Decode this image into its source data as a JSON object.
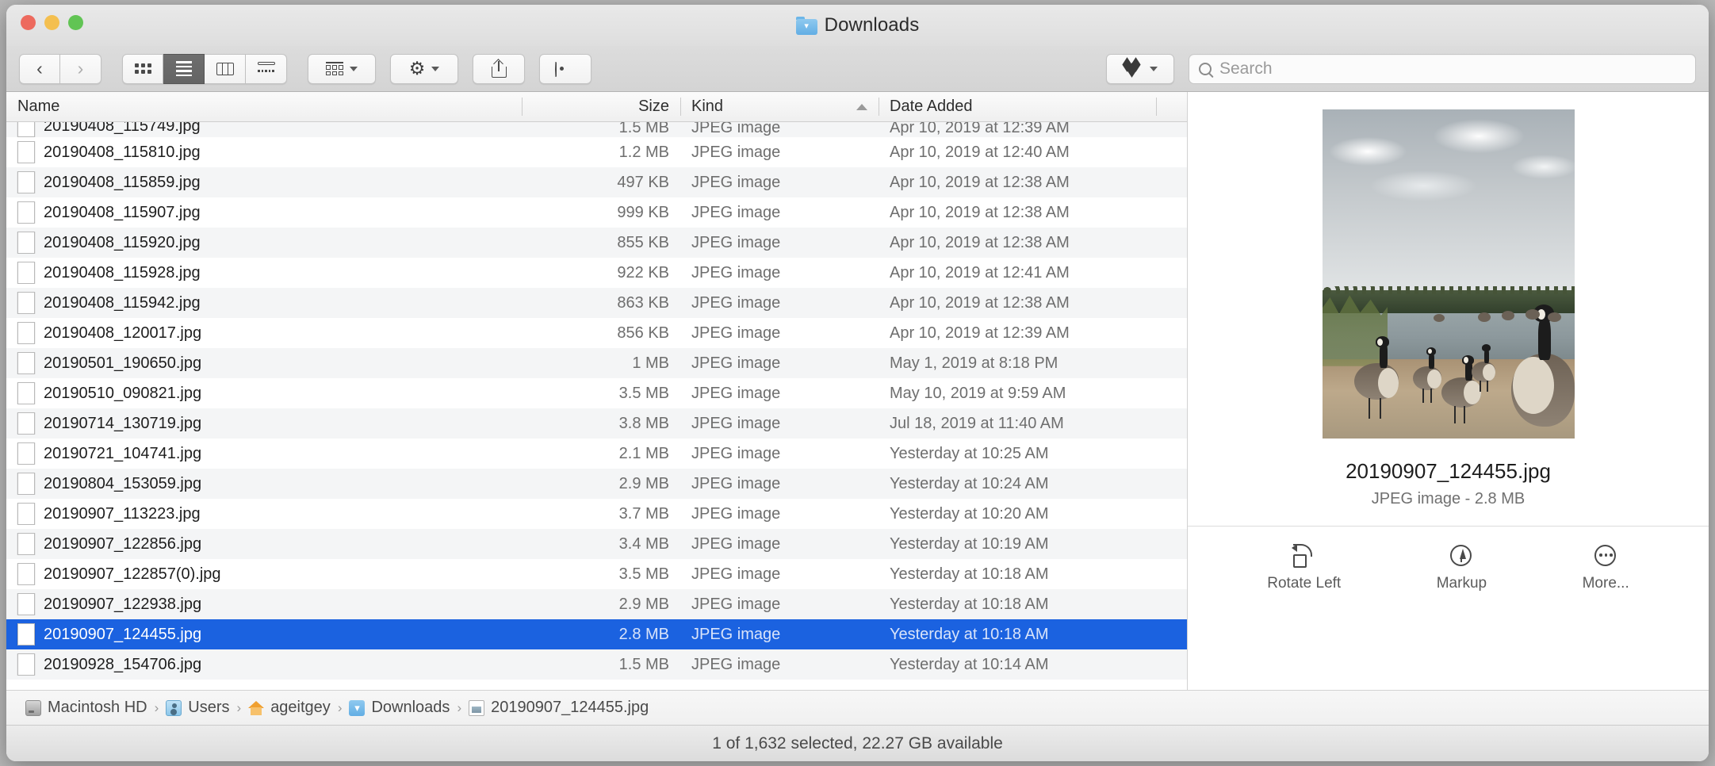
{
  "window": {
    "title": "Downloads",
    "title_icon": "downloads-folder-icon"
  },
  "toolbar": {
    "back_icon": "chevron-left-icon",
    "forward_icon": "chevron-right-icon",
    "view_icon_label": "icon-view",
    "view_list_label": "list-view",
    "view_column_label": "column-view",
    "view_gallery_label": "gallery-view",
    "arrange_label": "arrange-by",
    "action_label": "action-gear",
    "share_label": "share",
    "tags_label": "tags",
    "dropbox_label": "dropbox"
  },
  "search": {
    "placeholder": "Search",
    "value": ""
  },
  "columns": {
    "name": "Name",
    "size": "Size",
    "kind": "Kind",
    "date_added": "Date Added",
    "sorted_by": "Kind",
    "sort_direction": "ascending"
  },
  "files": [
    {
      "name": "20190408_115749.jpg",
      "size": "1.5 MB",
      "kind": "JPEG image",
      "date": "Apr 10, 2019 at 12:39 AM",
      "thumb": "#8c7a62",
      "clipped": true,
      "selected": false
    },
    {
      "name": "20190408_115810.jpg",
      "size": "1.2 MB",
      "kind": "JPEG image",
      "date": "Apr 10, 2019 at 12:40 AM",
      "thumb": "#c2aa86",
      "clipped": false,
      "selected": false
    },
    {
      "name": "20190408_115859.jpg",
      "size": "497 KB",
      "kind": "JPEG image",
      "date": "Apr 10, 2019 at 12:38 AM",
      "thumb": "#6f6252",
      "clipped": false,
      "selected": false
    },
    {
      "name": "20190408_115907.jpg",
      "size": "999 KB",
      "kind": "JPEG image",
      "date": "Apr 10, 2019 at 12:38 AM",
      "thumb": "#b09c74",
      "clipped": false,
      "selected": false
    },
    {
      "name": "20190408_115920.jpg",
      "size": "855 KB",
      "kind": "JPEG image",
      "date": "Apr 10, 2019 at 12:38 AM",
      "thumb": "#8b7a5e",
      "clipped": false,
      "selected": false
    },
    {
      "name": "20190408_115928.jpg",
      "size": "922 KB",
      "kind": "JPEG image",
      "date": "Apr 10, 2019 at 12:41 AM",
      "thumb": "#7a6a55",
      "clipped": false,
      "selected": false
    },
    {
      "name": "20190408_115942.jpg",
      "size": "863 KB",
      "kind": "JPEG image",
      "date": "Apr 10, 2019 at 12:38 AM",
      "thumb": "#9a8668",
      "clipped": false,
      "selected": false
    },
    {
      "name": "20190408_120017.jpg",
      "size": "856 KB",
      "kind": "JPEG image",
      "date": "Apr 10, 2019 at 12:39 AM",
      "thumb": "#a38f6d",
      "clipped": false,
      "selected": false
    },
    {
      "name": "20190501_190650.jpg",
      "size": "1 MB",
      "kind": "JPEG image",
      "date": "May 1, 2019 at 8:18 PM",
      "thumb": "#4a3a2c",
      "clipped": false,
      "selected": false
    },
    {
      "name": "20190510_090821.jpg",
      "size": "3.5 MB",
      "kind": "JPEG image",
      "date": "May 10, 2019 at 9:59 AM",
      "thumb": "#8e4f58",
      "clipped": false,
      "selected": false
    },
    {
      "name": "20190714_130719.jpg",
      "size": "3.8 MB",
      "kind": "JPEG image",
      "date": "Jul 18, 2019 at 11:40 AM",
      "thumb": "#6b8a4a",
      "clipped": false,
      "selected": false
    },
    {
      "name": "20190721_104741.jpg",
      "size": "2.1 MB",
      "kind": "JPEG image",
      "date": "Yesterday at 10:25 AM",
      "thumb": "#5f8a3f",
      "clipped": false,
      "selected": false
    },
    {
      "name": "20190804_153059.jpg",
      "size": "2.9 MB",
      "kind": "JPEG image",
      "date": "Yesterday at 10:24 AM",
      "thumb": "#74a04c",
      "clipped": false,
      "selected": false
    },
    {
      "name": "20190907_113223.jpg",
      "size": "3.7 MB",
      "kind": "JPEG image",
      "date": "Yesterday at 10:20 AM",
      "thumb": "#8d8f7d",
      "clipped": false,
      "selected": false
    },
    {
      "name": "20190907_122856.jpg",
      "size": "3.4 MB",
      "kind": "JPEG image",
      "date": "Yesterday at 10:19 AM",
      "thumb": "#7d7968",
      "clipped": false,
      "selected": false
    },
    {
      "name": "20190907_122857(0).jpg",
      "size": "3.5 MB",
      "kind": "JPEG image",
      "date": "Yesterday at 10:18 AM",
      "thumb": "#7d7968",
      "clipped": false,
      "selected": false
    },
    {
      "name": "20190907_122938.jpg",
      "size": "2.9 MB",
      "kind": "JPEG image",
      "date": "Yesterday at 10:18 AM",
      "thumb": "#9b8f76",
      "clipped": false,
      "selected": false
    },
    {
      "name": "20190907_124455.jpg",
      "size": "2.8 MB",
      "kind": "JPEG image",
      "date": "Yesterday at 10:18 AM",
      "thumb": "#a2947a",
      "clipped": false,
      "selected": true
    },
    {
      "name": "20190928_154706.jpg",
      "size": "1.5 MB",
      "kind": "JPEG image",
      "date": "Yesterday at 10:14 AM",
      "thumb": "#6d7b84",
      "clipped": false,
      "selected": false
    }
  ],
  "preview": {
    "filename": "20190907_124455.jpg",
    "meta": "JPEG image - 2.8 MB",
    "image_description": "Canada geese standing on gravel shore beside a lake under cloudy sky",
    "actions": [
      {
        "label": "Rotate Left",
        "icon": "rotate-left-icon"
      },
      {
        "label": "Markup",
        "icon": "markup-icon"
      },
      {
        "label": "More...",
        "icon": "more-icon"
      }
    ]
  },
  "path_bar": {
    "crumbs": [
      {
        "label": "Macintosh HD",
        "icon": "hard-drive-icon"
      },
      {
        "label": "Users",
        "icon": "users-folder-icon"
      },
      {
        "label": "ageitgey",
        "icon": "home-folder-icon"
      },
      {
        "label": "Downloads",
        "icon": "downloads-folder-icon"
      },
      {
        "label": "20190907_124455.jpg",
        "icon": "jpeg-file-icon"
      }
    ],
    "separator": "›"
  },
  "status_bar": {
    "text": "1 of 1,632 selected, 22.27 GB available"
  },
  "colors": {
    "selection_blue": "#1b62e0",
    "toolbar_gray": "#d8d8d8",
    "row_alt": "#f4f5f6"
  }
}
